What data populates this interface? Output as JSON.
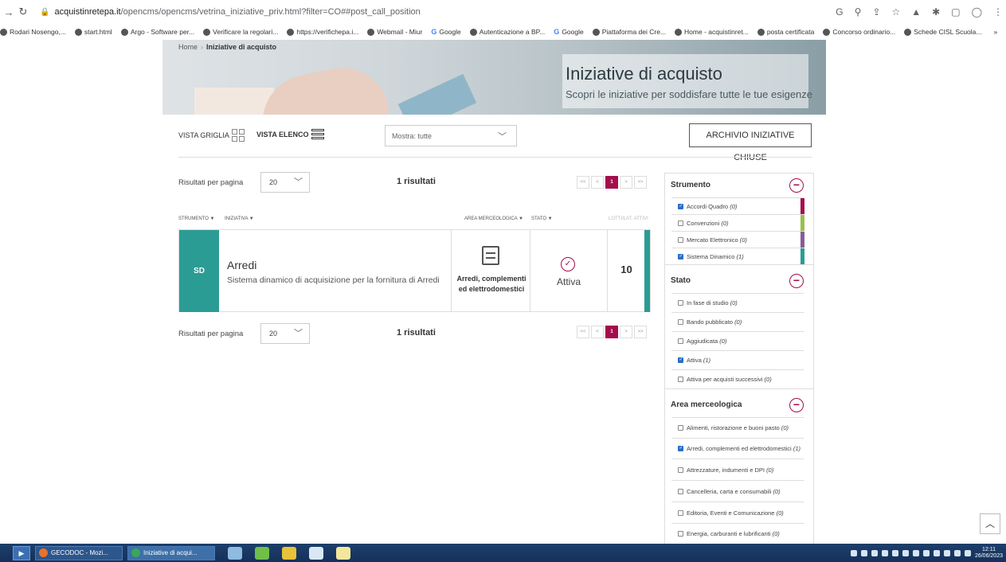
{
  "browser": {
    "url_host": "acquistinretepa.it",
    "url_path": "/opencms/opencms/vetrina_iniziative_priv.html?filter=CO##post_call_position",
    "bookmarks": [
      "Rodari Nosengo,...",
      "start.html",
      "Argo - Software per...",
      "Verificare la regolari...",
      "https://verifichepa.i...",
      "Webmail - Miur",
      "Google",
      "Autenticazione a BP...",
      "Google",
      "Piattaforma dei Cre...",
      "Home - acquistinret...",
      "posta certificata",
      "Concorso ordinario...",
      "Schede CISL Scuola..."
    ],
    "more": "»"
  },
  "breadcrumb": {
    "home": "Home",
    "current": "Iniziative di acquisto"
  },
  "hero": {
    "title": "Iniziative di acquisto",
    "subtitle": "Scopri le iniziative per soddisfare tutte le tue esigenze"
  },
  "toolbar": {
    "grid_label": "VISTA GRIGLIA",
    "list_label": "VISTA ELENCO",
    "mostra": "Mostra: tutte",
    "archivio": "ARCHIVIO INIZIATIVE CHIUSE"
  },
  "results": {
    "per_page_label": "Risultati per pagina",
    "per_page_value": "20",
    "count": "1 risultati",
    "pager": [
      "<<",
      "<",
      "1",
      ">",
      ">>"
    ]
  },
  "columns": {
    "strumento": "STRUMENTO ▼",
    "iniziativa": "INIZIATIVA ▼",
    "area": "AREA MERCEOLOGICA ▼",
    "stato": "STATO ▼",
    "lotti": "LOTTI/LAT. ATTIVI"
  },
  "card": {
    "badge": "SD",
    "name": "Arredi",
    "desc": "Sistema dinamico di acquisizione per la fornitura di Arredi",
    "area": "Arredi, complementi ed elettrodomestici",
    "stato": "Attiva",
    "lotti": "10",
    "color": "#2b9c94"
  },
  "sidebar": {
    "strumento": {
      "title": "Strumento",
      "items": [
        {
          "label": "Accordi Quadro",
          "count": "(0)",
          "checked": true,
          "color": "#a40e4c"
        },
        {
          "label": "Convenzioni",
          "count": "(0)",
          "checked": false,
          "color": "#9bbf4a"
        },
        {
          "label": "Mercato Elettronico",
          "count": "(0)",
          "checked": false,
          "color": "#8a5a9c"
        },
        {
          "label": "Sistema Dinamico",
          "count": "(1)",
          "checked": true,
          "color": "#2b9c94"
        }
      ]
    },
    "stato": {
      "title": "Stato",
      "items": [
        {
          "label": "In fase di studio",
          "count": "(0)",
          "checked": false
        },
        {
          "label": "Bando pubblicato",
          "count": "(0)",
          "checked": false
        },
        {
          "label": "Aggiudicata",
          "count": "(0)",
          "checked": false
        },
        {
          "label": "Attiva",
          "count": "(1)",
          "checked": true
        },
        {
          "label": "Attiva per acquisti successivi",
          "count": "(0)",
          "checked": false
        }
      ]
    },
    "area": {
      "title": "Area merceologica",
      "items": [
        {
          "label": "Alimenti, ristorazione e buoni pasto",
          "count": "(0)",
          "checked": false
        },
        {
          "label": "Arredi, complementi ed elettrodomestici",
          "count": "(1)",
          "checked": true
        },
        {
          "label": "Attrezzature, indumenti e DPI",
          "count": "(0)",
          "checked": false
        },
        {
          "label": "Cancelleria, carta e consumabili",
          "count": "(0)",
          "checked": false
        },
        {
          "label": "Editoria, Eventi e Comunicazione",
          "count": "(0)",
          "checked": false
        },
        {
          "label": "Energia, carburanti e lubrificanti",
          "count": "(0)",
          "checked": false
        }
      ]
    }
  },
  "taskbar": {
    "tasks": [
      "GECODOC - Mozi...",
      "Iniziative di acqui..."
    ],
    "time": "12:11",
    "date": "26/06/2023"
  },
  "colors": {
    "accent": "#a40e4c",
    "teal": "#2b9c94"
  }
}
